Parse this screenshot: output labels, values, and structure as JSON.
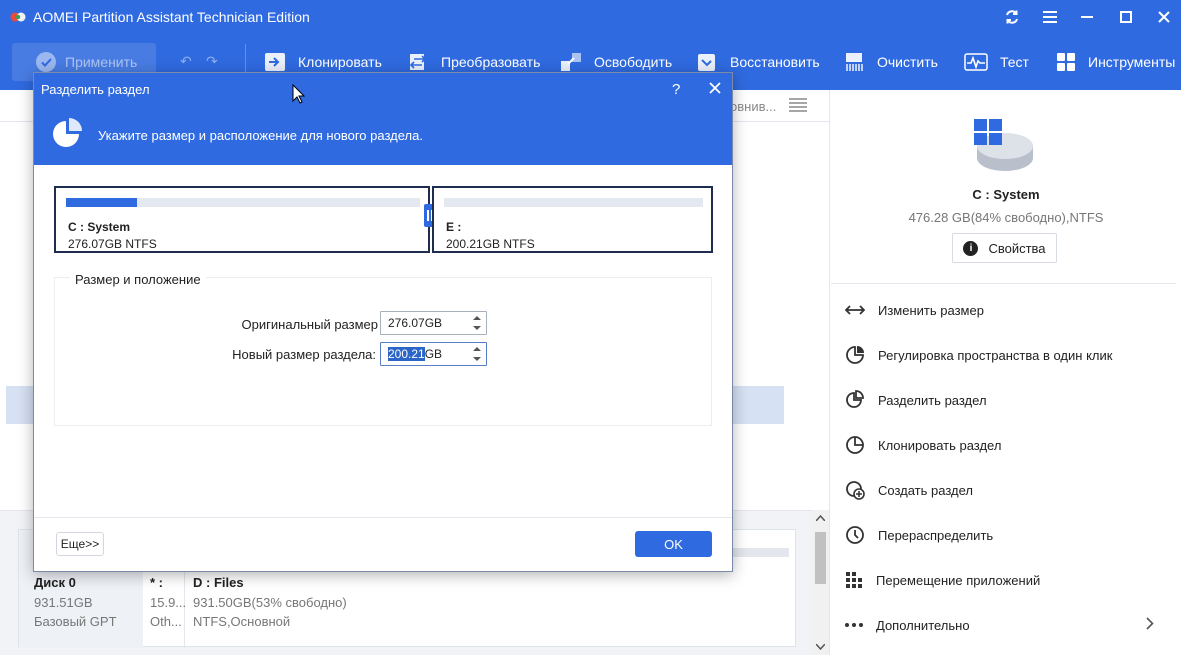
{
  "app": {
    "title": "AOMEI Partition Assistant Technician Edition"
  },
  "toolbar": {
    "apply_label": "Применить",
    "items": [
      {
        "label": "Клонировать",
        "icon": "clone-icon"
      },
      {
        "label": "Преобразовать",
        "icon": "convert-icon"
      },
      {
        "label": "Освободить",
        "icon": "free-space-icon"
      },
      {
        "label": "Восстановить",
        "icon": "recover-icon"
      },
      {
        "label": "Очистить",
        "icon": "wipe-icon"
      },
      {
        "label": "Тест",
        "icon": "test-icon"
      },
      {
        "label": "Инструменты",
        "icon": "tools-icon"
      }
    ]
  },
  "main": {
    "column_header_partial": "овнив...",
    "disk": {
      "name": "Диск 0",
      "size": "931.51GB",
      "type": "Базовый GPT",
      "part1_name": "* :",
      "part1_size": "15.9...",
      "part1_type": "Oth...",
      "part2_name": "D : Files",
      "part2_size": "931.50GB(53% свободно)",
      "part2_type": "NTFS,Основной"
    }
  },
  "right_panel": {
    "partition_name": "C : System",
    "partition_info": "476.28 GB(84% свободно),NTFS",
    "properties_label": "Свойства",
    "operations": [
      {
        "label": "Изменить размер",
        "icon": "resize-icon"
      },
      {
        "label": "Регулировка пространства в один клик",
        "icon": "one-click-adjust-icon"
      },
      {
        "label": "Разделить раздел",
        "icon": "split-partition-icon"
      },
      {
        "label": "Клонировать раздел",
        "icon": "clone-partition-icon"
      },
      {
        "label": "Создать раздел",
        "icon": "create-partition-icon"
      },
      {
        "label": "Перераспределить",
        "icon": "allocate-space-icon"
      },
      {
        "label": "Перемещение приложений",
        "icon": "app-mover-icon"
      },
      {
        "label": "Дополнительно",
        "icon": "more-icon"
      }
    ]
  },
  "dialog": {
    "title": "Разделить раздел",
    "subtitle": "Укажите размер и расположение для нового раздела.",
    "left_partition": {
      "name": "C : System",
      "size": "276.07GB NTFS",
      "used_fraction": 0.2
    },
    "right_partition": {
      "name": "E :",
      "size": "200.21GB NTFS",
      "used_fraction": 0.0
    },
    "group_title": "Размер и положение",
    "original_size_label": "Оригинальный размер",
    "original_size_value": "276.07GB",
    "new_size_label": "Новый размер раздела:",
    "new_size_selected": "200.21",
    "new_size_unit": "GB",
    "more_label": "Еще>>",
    "ok_label": "OK"
  }
}
